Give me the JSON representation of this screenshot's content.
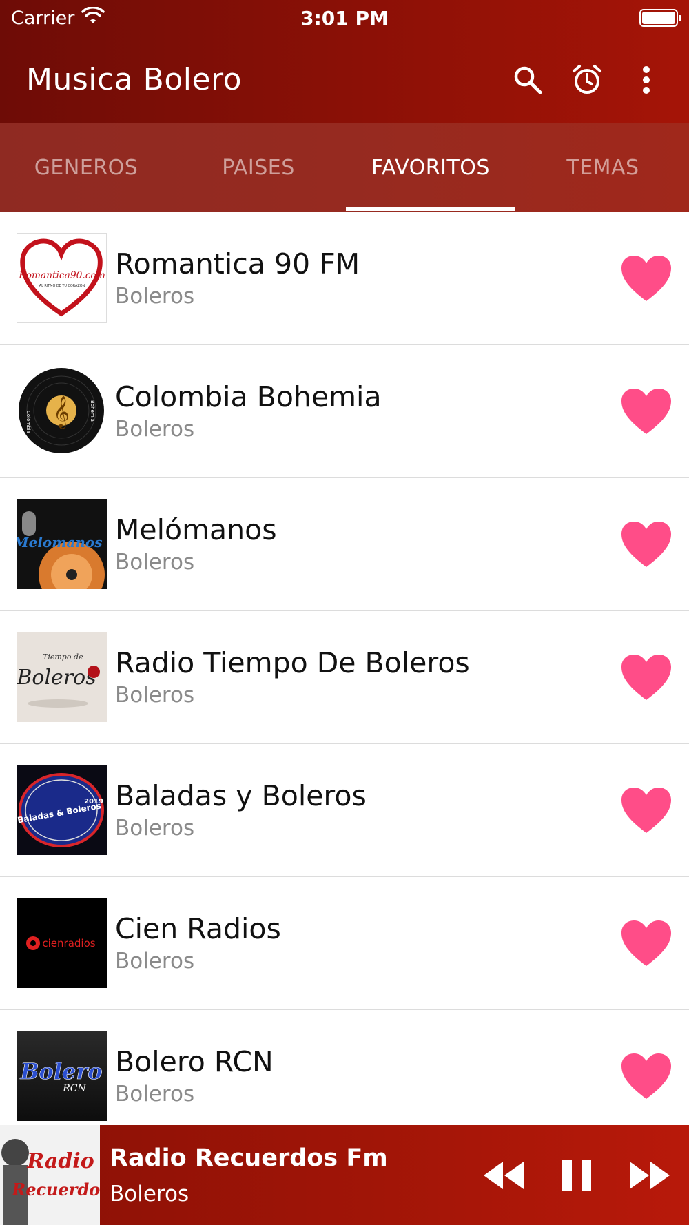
{
  "status_bar": {
    "carrier": "Carrier",
    "time": "3:01 PM"
  },
  "app_bar": {
    "title": "Musica Bolero",
    "icons": [
      "search-icon",
      "alarm-icon",
      "more-vertical-icon"
    ]
  },
  "tabs": [
    {
      "label": "GENEROS",
      "active": false
    },
    {
      "label": "PAISES",
      "active": false
    },
    {
      "label": "FAVORITOS",
      "active": true
    },
    {
      "label": "TEMAS",
      "active": false
    }
  ],
  "stations": [
    {
      "name": "Romantica 90 FM",
      "genre": "Boleros",
      "logo_text": "Romantica90.com",
      "logo_subtext": "AL RITMO DE TU CORAZON"
    },
    {
      "name": "Colombia Bohemia",
      "genre": "Boleros",
      "logo_text": "Colombia",
      "logo_subtext": "Bohemia"
    },
    {
      "name": "Melómanos",
      "genre": "Boleros",
      "logo_text": "Melomanos",
      "logo_subtext": ""
    },
    {
      "name": "Radio Tiempo De Boleros",
      "genre": "Boleros",
      "logo_text": "Boleros",
      "logo_subtext": "Tiempo de"
    },
    {
      "name": "Baladas y Boleros",
      "genre": "Boleros",
      "logo_text": "Baladas & Boleros",
      "logo_subtext": "2019"
    },
    {
      "name": "Cien Radios",
      "genre": "Boleros",
      "logo_text": "cienradios",
      "logo_subtext": ""
    },
    {
      "name": "Bolero RCN",
      "genre": "Boleros",
      "logo_text": "Bolero",
      "logo_subtext": "RCN"
    }
  ],
  "player": {
    "title": "Radio Recuerdos Fm",
    "subtitle": "Boleros",
    "logo_text_1": "Radio",
    "logo_text_2": "Recuerdos",
    "state": "playing"
  },
  "colors": {
    "brand_red": "#8a1006",
    "favorite_pink": "#ff4d88",
    "tab_bar": "#962a20"
  }
}
